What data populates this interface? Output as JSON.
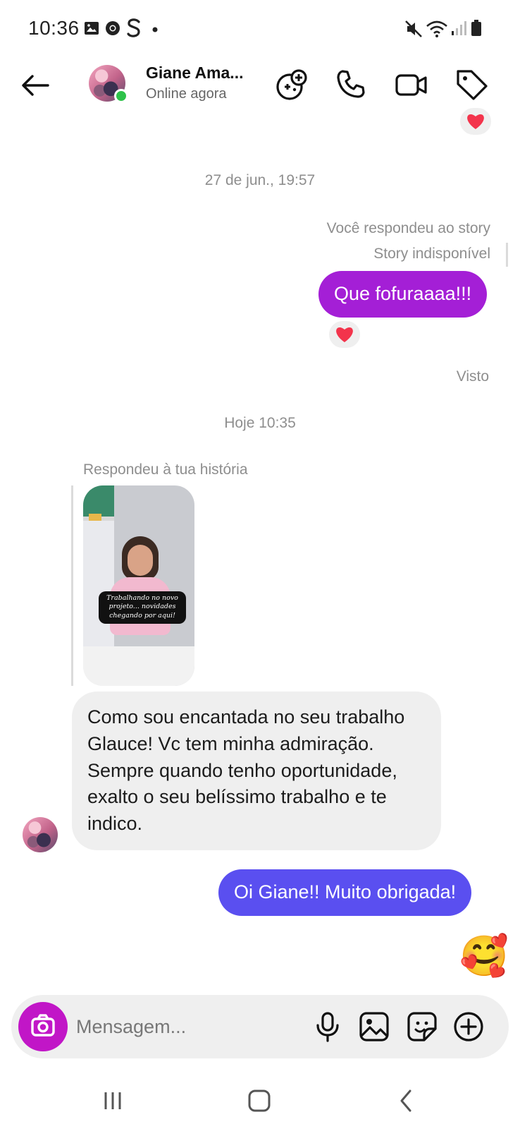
{
  "status_bar": {
    "time": "10:36",
    "icons": [
      "gallery-icon",
      "chrome-icon",
      "s-app-icon",
      "dot-icon",
      "mute-icon",
      "wifi-icon",
      "signal-icon",
      "battery-icon"
    ]
  },
  "header": {
    "contact_name": "Giane Ama...",
    "status": "Online agora",
    "buttons": [
      "games-icon",
      "phone-icon",
      "video-icon",
      "tag-icon"
    ]
  },
  "chat": {
    "date_1": "27 de jun., 19:57",
    "story_reply_note": "Você respondeu ao story",
    "story_unavailable": "Story indisponível",
    "msg_out_1": "Que fofuraaaa!!!",
    "seen": "Visto",
    "date_2": "Hoje 10:35",
    "story_reply_in_note": "Respondeu à tua história",
    "story_caption": "Trabalhando no novo projeto... novidades chegando por aqui!",
    "msg_in_1": "Como sou encantada no seu trabalho Glauce! Vc tem minha admiração. Sempre quando tenho oportunidade, exalto o seu belíssimo trabalho e te indico.",
    "msg_out_2": "Oi Giane!! Muito obrigada!",
    "emoji_reply": "🥰"
  },
  "composer": {
    "placeholder": "Mensagem..."
  },
  "colors": {
    "accent_purple": "#a41fd6",
    "bubble_blue_violet": "#5a4ff0",
    "camera_magenta": "#c116c7",
    "online_green": "#2ec24a"
  }
}
